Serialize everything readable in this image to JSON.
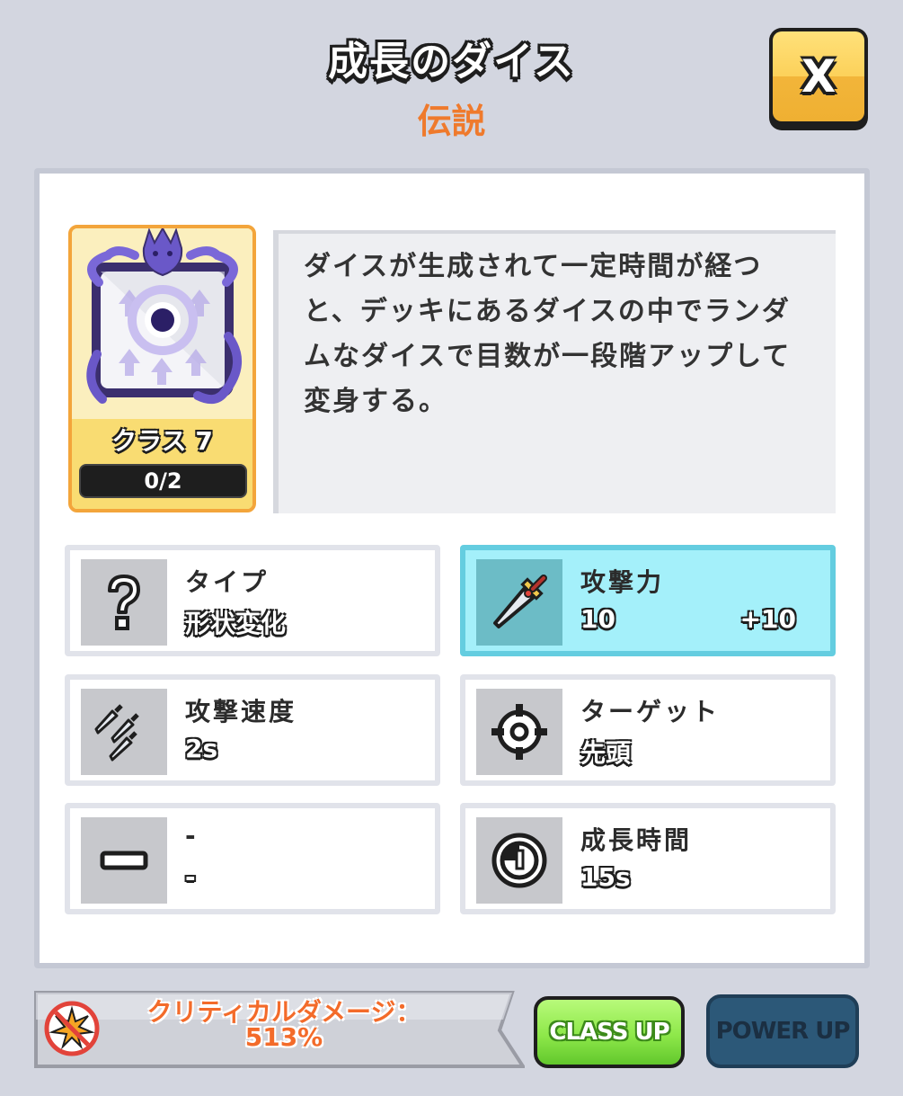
{
  "header": {
    "title": "成長のダイス",
    "rarity": "伝説",
    "close_label": "X"
  },
  "dice": {
    "class_label": "クラス 7",
    "progress": "0/2",
    "progress_value": 0,
    "progress_max": 2
  },
  "description": "ダイスが生成されて一定時間が経つと、デッキにあるダイスの中でランダムなダイスで目数が一段階アップして変身する。",
  "stats": {
    "type": {
      "label": "タイプ",
      "value": "形状変化",
      "icon": "question-icon"
    },
    "attack": {
      "label": "攻撃力",
      "value": "10",
      "bonus": "+10",
      "icon": "sword-icon"
    },
    "attack_speed": {
      "label": "攻撃速度",
      "value": "2s",
      "icon": "triple-sword-icon"
    },
    "target": {
      "label": "ターゲット",
      "value": "先頭",
      "icon": "crosshair-icon"
    },
    "empty": {
      "label": "-",
      "value": "-",
      "icon": "minus-icon"
    },
    "growth_time": {
      "label": "成長時間",
      "value": "15s",
      "icon": "timer-icon"
    }
  },
  "footer": {
    "critical_label": "クリティカルダメージ：",
    "critical_value": "513%",
    "class_up": "CLASS UP",
    "power_up": "POWER UP"
  },
  "colors": {
    "background": "#d3d6e0",
    "rarity": "#ef7a2c",
    "highlight": "#a4f0fa",
    "class_up": "#8ee84a",
    "power_up": "#2c5878",
    "close": "#fcd15a"
  }
}
